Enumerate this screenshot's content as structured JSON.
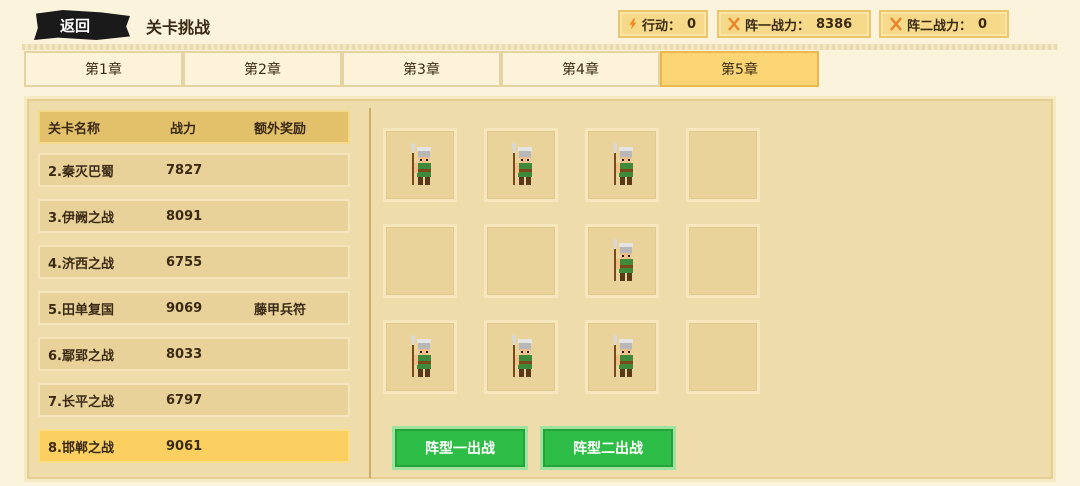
{
  "header": {
    "back_label": "返回",
    "title": "关卡挑战",
    "stats": [
      {
        "label": "行动：",
        "value": "0",
        "icon": "lightning-icon"
      },
      {
        "label": "阵一战力：",
        "value": "8386",
        "icon": "crossed-swords-icon"
      },
      {
        "label": "阵二战力：",
        "value": "0",
        "icon": "crossed-swords-icon"
      }
    ]
  },
  "tabs": [
    {
      "label": "第1章",
      "active": false
    },
    {
      "label": "第2章",
      "active": false
    },
    {
      "label": "第3章",
      "active": false
    },
    {
      "label": "第4章",
      "active": false
    },
    {
      "label": "第5章",
      "active": true
    }
  ],
  "stage_list": {
    "columns": [
      "关卡名称",
      "战力",
      "额外奖励"
    ],
    "rows": [
      {
        "name": "2.秦灭巴蜀",
        "power": "7827",
        "reward": ""
      },
      {
        "name": "3.伊阙之战",
        "power": "8091",
        "reward": ""
      },
      {
        "name": "4.济西之战",
        "power": "6755",
        "reward": ""
      },
      {
        "name": "5.田单复国",
        "power": "9069",
        "reward": "藤甲兵符"
      },
      {
        "name": "6.鄢郢之战",
        "power": "8033",
        "reward": ""
      },
      {
        "name": "7.长平之战",
        "power": "6797",
        "reward": ""
      },
      {
        "name": "8.邯郸之战",
        "power": "9061",
        "reward": ""
      }
    ],
    "selected_index": 6
  },
  "formation_grid": {
    "rows": 3,
    "cols": 4,
    "occupied": [
      [
        true,
        true,
        true,
        false
      ],
      [
        false,
        false,
        true,
        false
      ],
      [
        true,
        true,
        true,
        false
      ]
    ],
    "unit_icon": "spear-soldier-icon"
  },
  "buttons": {
    "formation1": "阵型一出战",
    "formation2": "阵型二出战"
  },
  "colors": {
    "background": "#fbf3dc",
    "tab_active": "#fbd574",
    "row_selected": "#fbd061",
    "button_green": "#2ebd46"
  }
}
